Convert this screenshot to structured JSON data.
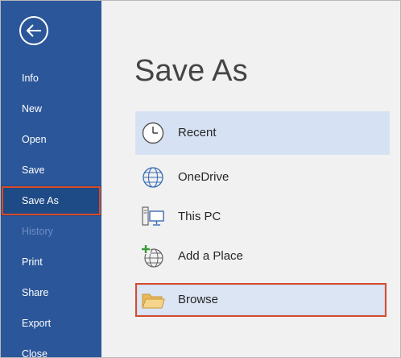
{
  "sidebar": {
    "items": [
      {
        "label": "Info"
      },
      {
        "label": "New"
      },
      {
        "label": "Open"
      },
      {
        "label": "Save"
      },
      {
        "label": "Save As"
      },
      {
        "label": "History"
      },
      {
        "label": "Print"
      },
      {
        "label": "Share"
      },
      {
        "label": "Export"
      },
      {
        "label": "Close"
      }
    ],
    "selected": "Save As",
    "disabled": [
      "History"
    ]
  },
  "main": {
    "title": "Save As",
    "locations": [
      {
        "label": "Recent",
        "icon": "clock-icon",
        "state": "highlighted"
      },
      {
        "label": "OneDrive",
        "icon": "globe-icon"
      },
      {
        "label": "This PC",
        "icon": "computer-icon"
      },
      {
        "label": "Add a Place",
        "icon": "add-place-icon"
      },
      {
        "label": "Browse",
        "icon": "folder-icon",
        "state": "selected"
      }
    ]
  },
  "colors": {
    "sidebar": "#2b579a",
    "selection_outline": "#d84b2a",
    "highlight": "#d6e2f3"
  }
}
